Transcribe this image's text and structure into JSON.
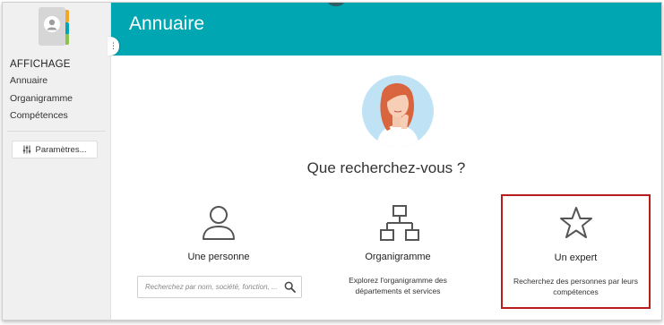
{
  "sidebar": {
    "heading": "AFFICHAGE",
    "links": [
      "Annuaire",
      "Organigramme",
      "Compétences"
    ],
    "settings_label": "Paramètres..."
  },
  "header": {
    "title": "Annuaire"
  },
  "main": {
    "question": "Que recherchez-vous ?",
    "options": {
      "person": {
        "title": "Une personne",
        "search_placeholder": "Recherchez par nom, société, fonction, ..."
      },
      "org": {
        "title": "Organigramme",
        "description": "Explorez l'organigramme des départements et services"
      },
      "expert": {
        "title": "Un expert",
        "description": "Recherchez des personnes par leurs compétences"
      }
    }
  },
  "colors": {
    "header": "#00a7b3",
    "highlight_border": "#b81c1c",
    "sidebar_bg": "#f0f0f0"
  },
  "icons": {
    "app": "contacts-book-icon",
    "collapse": "menu-handle-icon",
    "settings": "sliders-icon",
    "person": "user-outline-icon",
    "org": "org-chart-icon",
    "expert": "star-outline-icon",
    "search": "search-icon"
  }
}
